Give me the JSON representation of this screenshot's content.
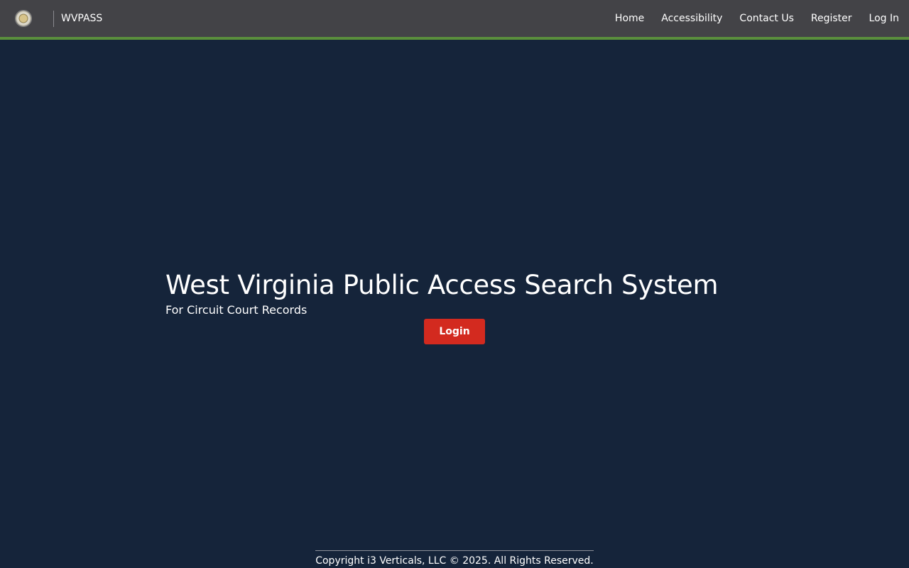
{
  "header": {
    "brand": "WVPASS",
    "nav": [
      "Home",
      "Accessibility",
      "Contact Us",
      "Register",
      "Log In"
    ]
  },
  "hero": {
    "title": "West Virginia Public Access Search System",
    "subtitle": "For Circuit Court Records",
    "login_label": "Login"
  },
  "footer": {
    "copyright": "Copyright i3 Verticals, LLC © 2025. All Rights Reserved."
  },
  "colors": {
    "header_bg": "#434347",
    "header_accent": "#5a8f3c",
    "page_bg": "#15243a",
    "login_button": "#d32a1f"
  },
  "icons": {
    "logo": "wv-state-seal-icon"
  }
}
